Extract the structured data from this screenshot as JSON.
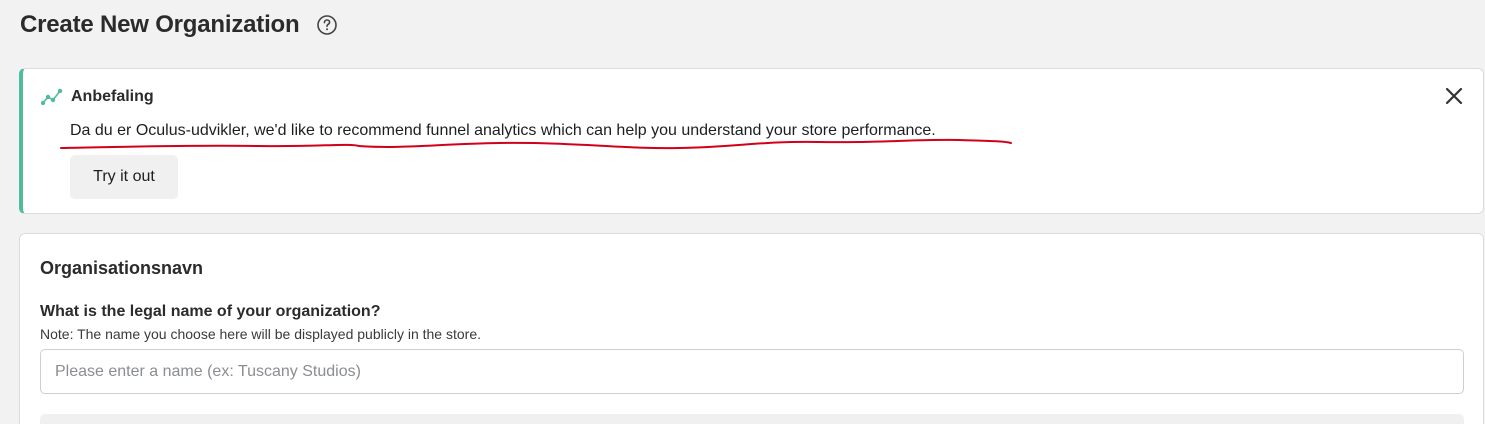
{
  "page": {
    "title": "Create New Organization",
    "help_icon": "question-circle-icon"
  },
  "recommendation": {
    "icon": "trend-chart-icon",
    "accent_color": "#4fbca0",
    "title": "Anbefaling",
    "message": "Da du er Oculus-udvikler, we'd like to recommend funnel analytics which can help you understand your store performance.",
    "annotation_color": "#d0021b",
    "cta_label": "Try it out",
    "close_icon": "close-icon"
  },
  "organization": {
    "section_title": "Organisationsnavn",
    "field_label": "What is the legal name of your organization?",
    "field_note": "Note: The name you choose here will be displayed publicly in the store.",
    "name_input": {
      "value": "",
      "placeholder": "Please enter a name (ex: Tuscany Studios)"
    }
  }
}
